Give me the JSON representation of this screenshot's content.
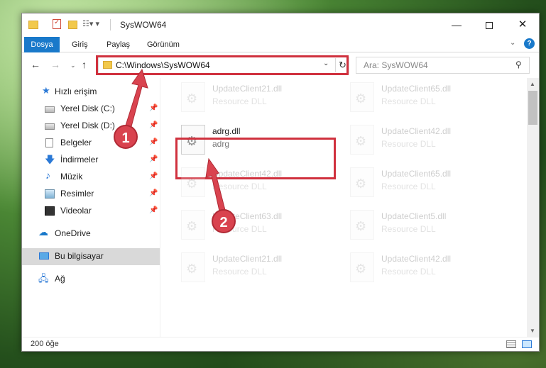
{
  "window": {
    "title": "SysWOW64"
  },
  "ribbon": {
    "file_tab": "Dosya",
    "home_tab": "Giriş",
    "share_tab": "Paylaş",
    "view_tab": "Görünüm"
  },
  "address_bar": {
    "path": "C:\\Windows\\SysWOW64"
  },
  "search": {
    "placeholder": "Ara: SysWOW64"
  },
  "sidebar": {
    "quick_access": "Hızlı erişim",
    "items": [
      {
        "label": "Yerel Disk (C:)",
        "icon": "drive-icon",
        "pinned": true
      },
      {
        "label": "Yerel Disk (D:)",
        "icon": "drive-icon",
        "pinned": true
      },
      {
        "label": "Belgeler",
        "icon": "documents-icon",
        "pinned": true
      },
      {
        "label": "İndirmeler",
        "icon": "downloads-icon",
        "pinned": true
      },
      {
        "label": "Müzik",
        "icon": "music-icon",
        "pinned": true
      },
      {
        "label": "Resimler",
        "icon": "pictures-icon",
        "pinned": true
      },
      {
        "label": "Videolar",
        "icon": "videos-icon",
        "pinned": true
      }
    ],
    "onedrive": "OneDrive",
    "this_pc": "Bu bilgisayar",
    "network": "Ağ"
  },
  "files": [
    {
      "name": "UpdateClient21.dll",
      "type": "Resource DLL",
      "faded": true
    },
    {
      "name": "UpdateClient65.dll",
      "type": "Resource DLL",
      "faded": true
    },
    {
      "name": "adrg.dll",
      "type": "adrg",
      "faded": false,
      "highlighted": true
    },
    {
      "name": "UpdateClient42.dll",
      "type": "Resource DLL",
      "faded": true
    },
    {
      "name": "UpdateClient42.dll",
      "type": "Resource DLL",
      "faded": true
    },
    {
      "name": "UpdateClient65.dll",
      "type": "Resource DLL",
      "faded": true
    },
    {
      "name": "UpdateClient63.dll",
      "type": "Resource DLL",
      "faded": true
    },
    {
      "name": "UpdateClient5.dll",
      "type": "Resource DLL",
      "faded": true
    },
    {
      "name": "UpdateClient21.dll",
      "type": "Resource DLL",
      "faded": true
    },
    {
      "name": "UpdateClient42.dll",
      "type": "Resource DLL",
      "faded": true
    }
  ],
  "status": {
    "item_count": "200 öğe"
  },
  "callouts": {
    "step1": "1",
    "step2": "2"
  },
  "colors": {
    "accent": "#1979ca",
    "highlight": "#d0313e",
    "callout": "#d9434f"
  }
}
